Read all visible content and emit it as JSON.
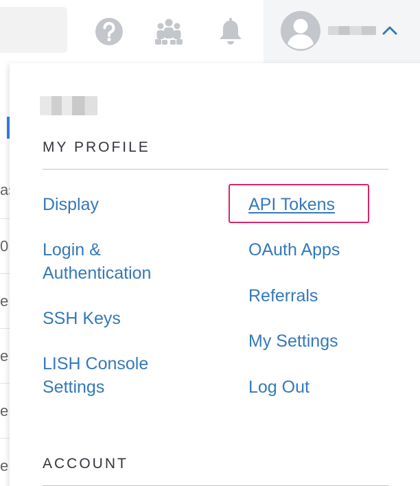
{
  "topbar": {
    "icons": [
      "help-icon",
      "community-icon",
      "bell-icon"
    ],
    "user_menu_icon": "chevron-up-icon"
  },
  "background_fragments": [
    "as",
    "0",
    "e",
    "e",
    "e",
    "e"
  ],
  "dropdown": {
    "my_profile": {
      "title": "MY PROFILE",
      "left_links": [
        {
          "label": "Display"
        },
        {
          "label": "Login &\nAuthentication"
        },
        {
          "label": "SSH Keys"
        },
        {
          "label": "LISH Console\nSettings"
        }
      ],
      "right_links": [
        {
          "label": "API Tokens",
          "highlighted": true
        },
        {
          "label": "OAuth Apps"
        },
        {
          "label": "Referrals"
        },
        {
          "label": "My Settings"
        },
        {
          "label": "Log Out"
        }
      ]
    },
    "account": {
      "title": "ACCOUNT"
    }
  },
  "colors": {
    "link": "#3479b9",
    "highlight": "#d9236a",
    "icon": "#c3c6ca"
  }
}
